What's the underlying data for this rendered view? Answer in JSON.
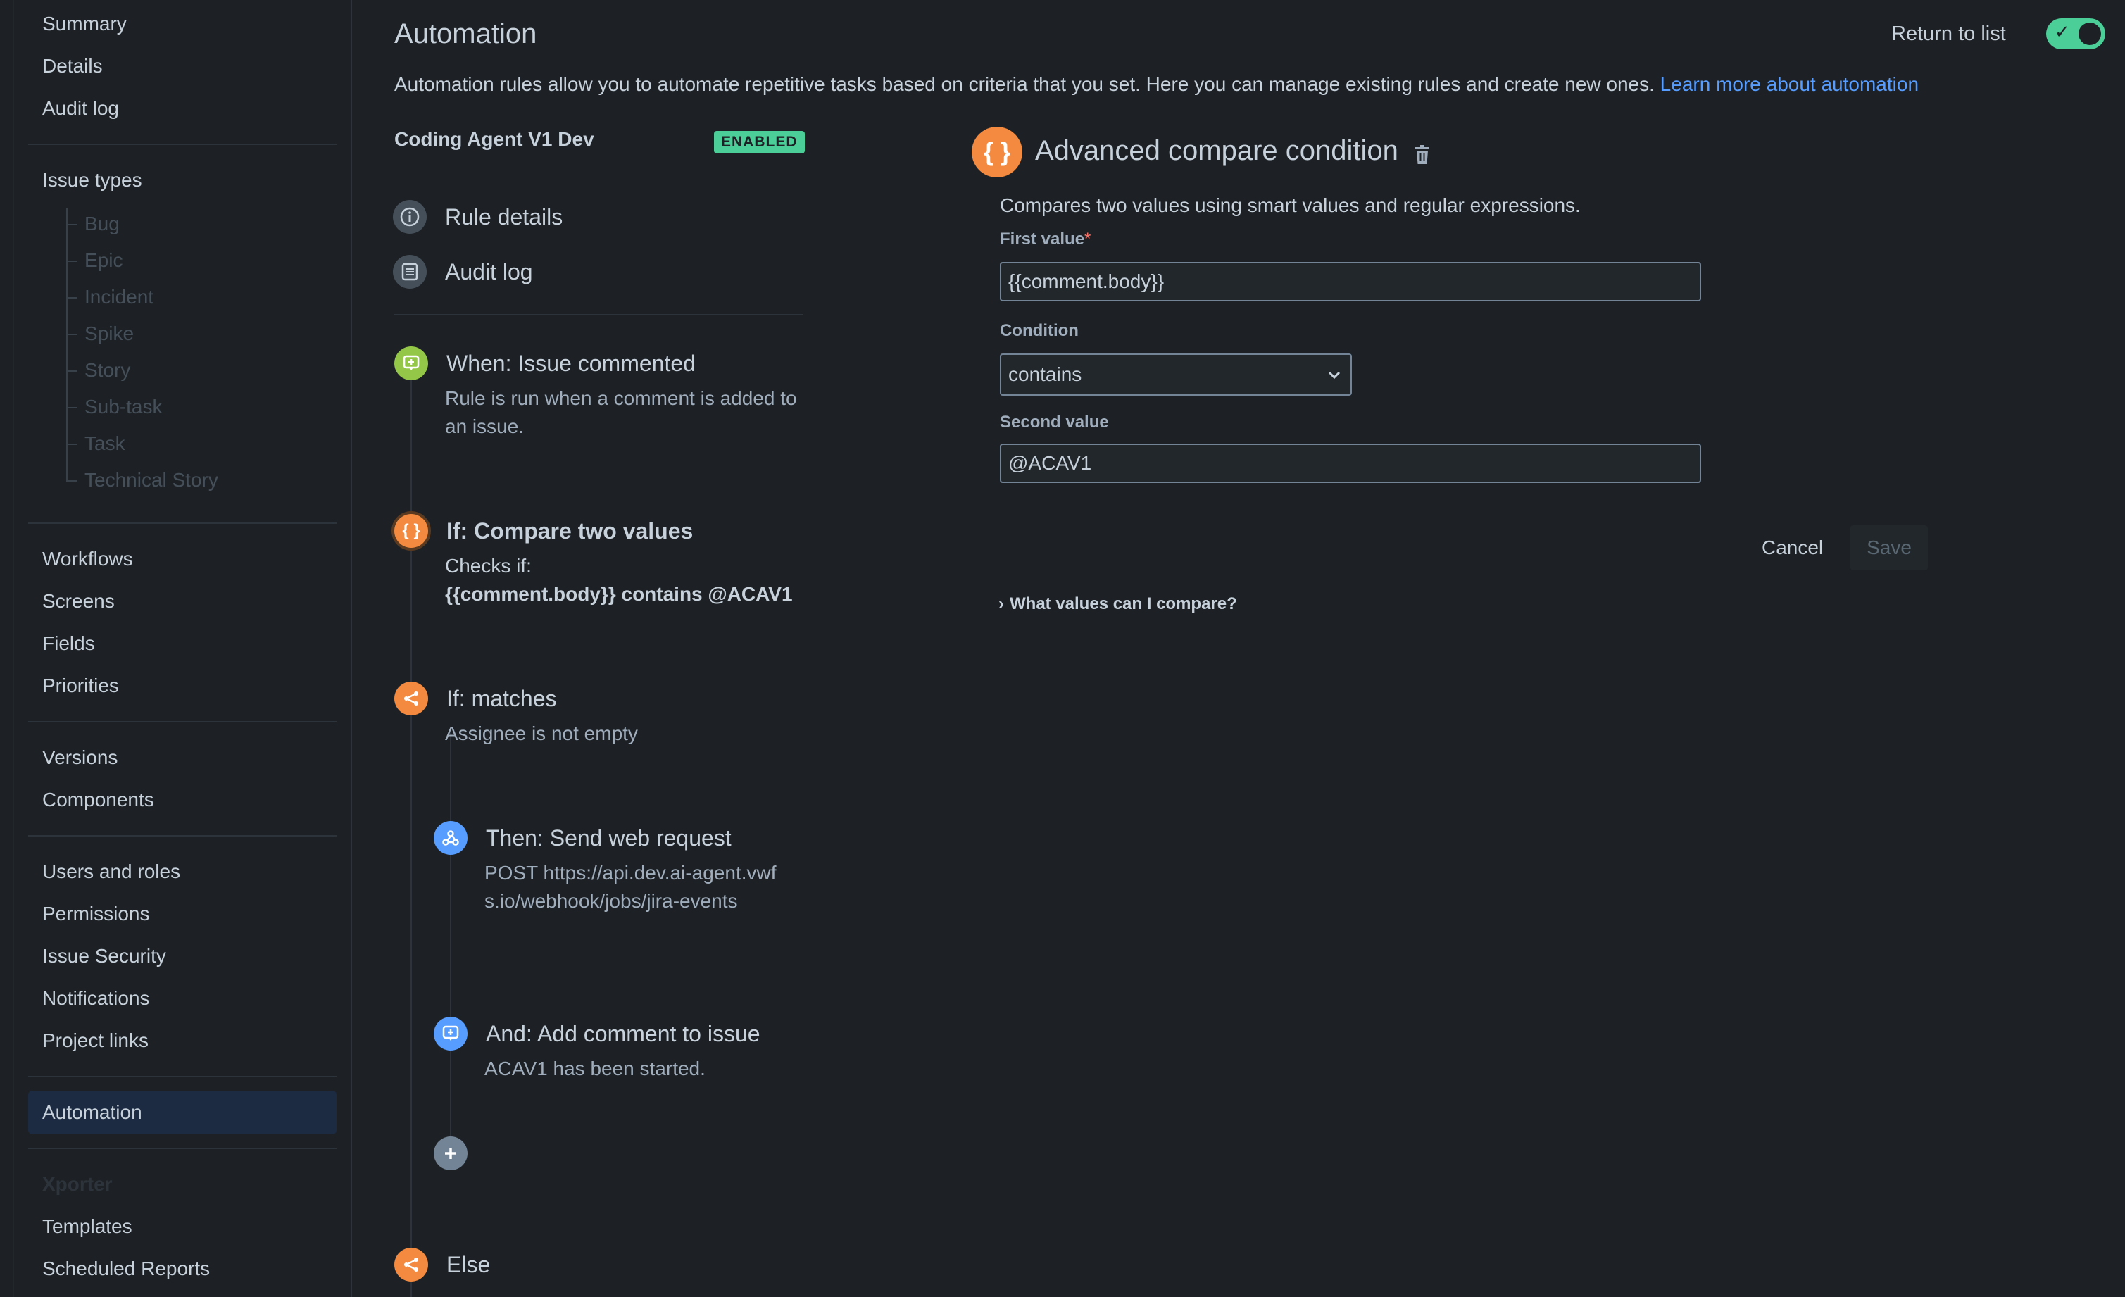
{
  "sidebar": {
    "top_items": [
      "Summary",
      "Details",
      "Audit log"
    ],
    "issue_types_label": "Issue types",
    "issue_types": [
      "Bug",
      "Epic",
      "Incident",
      "Spike",
      "Story",
      "Sub-task",
      "Task",
      "Technical Story"
    ],
    "group1": [
      "Workflows",
      "Screens",
      "Fields",
      "Priorities"
    ],
    "group2": [
      "Versions",
      "Components"
    ],
    "group3": [
      "Users and roles",
      "Permissions",
      "Issue Security",
      "Notifications",
      "Project links"
    ],
    "active_item": "Automation",
    "xporter_heading": "Xporter",
    "xporter_items": [
      "Templates",
      "Scheduled Reports"
    ]
  },
  "header": {
    "title": "Automation",
    "return_link": "Return to list",
    "intro_text": "Automation rules allow you to automate repetitive tasks based on criteria that you set. Here you can manage existing rules and create new ones.",
    "intro_link": "Learn more about automation"
  },
  "rule": {
    "name": "Coding Agent V1 Dev",
    "status": "ENABLED",
    "nav": [
      {
        "label": "Rule details",
        "icon": "info-icon"
      },
      {
        "label": "Audit log",
        "icon": "list-icon"
      }
    ],
    "steps": {
      "trigger": {
        "title": "When: Issue commented",
        "desc": "Rule is run when a comment is added to an issue.",
        "icon": "comment-icon",
        "color": "#94c748"
      },
      "condition": {
        "title": "If: Compare two values",
        "desc_line1": "Checks if:",
        "desc_line2": "{{comment.body}} contains @ACAV1",
        "icon": "braces-icon",
        "color": "#f38a3f"
      },
      "branch_if": {
        "title": "If: matches",
        "desc": "Assignee is not empty",
        "icon": "branch-icon",
        "color": "#f38a3f"
      },
      "action1": {
        "title": "Then: Send web request",
        "desc": "POST https://api.dev.ai-agent.vwfs.io/webhook/jobs/jira-events",
        "icon": "webhook-icon",
        "color": "#579dff"
      },
      "action2": {
        "title": "And: Add comment to issue",
        "desc": "ACAV1 has been started.",
        "icon": "comment-icon",
        "color": "#579dff"
      },
      "else": {
        "title": "Else",
        "icon": "branch-icon",
        "color": "#f38a3f"
      }
    }
  },
  "panel": {
    "title": "Advanced compare condition",
    "description": "Compares two values using smart values and regular expressions.",
    "first_value_label": "First value",
    "required_mark": "*",
    "first_value": "{{comment.body}}",
    "condition_label": "Condition",
    "condition_value": "contains",
    "second_value_label": "Second value",
    "second_value": "@ACAV1",
    "cancel_label": "Cancel",
    "save_label": "Save",
    "faq_label": "What values can I compare?"
  }
}
